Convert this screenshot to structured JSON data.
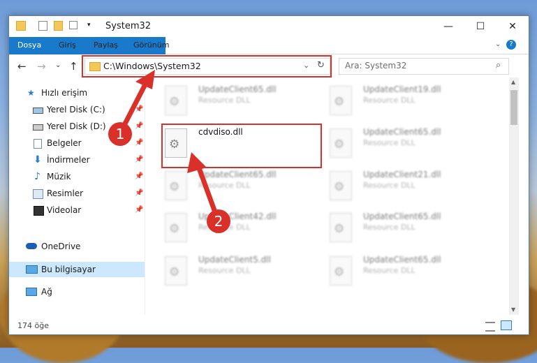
{
  "window": {
    "title": "System32",
    "controls": {
      "minimize": "—",
      "maximize": "☐",
      "close": "✕"
    }
  },
  "ribbon": {
    "tabs": [
      "Dosya",
      "Giriş",
      "Paylaş",
      "Görünüm"
    ],
    "help_icon": "?"
  },
  "navigation": {
    "back_icon": "←",
    "forward_icon": "→",
    "recent_icon": "⌄",
    "up_icon": "↑",
    "address": "C:\\Windows\\System32",
    "search_placeholder": "Ara: System32"
  },
  "sidebar": {
    "items": [
      {
        "label": "Hızlı erişim",
        "icon": "star-icon"
      },
      {
        "label": "Yerel Disk (C:)",
        "icon": "drive-icon",
        "pinned": true
      },
      {
        "label": "Yerel Disk (D:)",
        "icon": "drive-icon",
        "pinned": true
      },
      {
        "label": "Belgeler",
        "icon": "document-icon",
        "pinned": true
      },
      {
        "label": "İndirmeler",
        "icon": "download-icon",
        "pinned": true
      },
      {
        "label": "Müzik",
        "icon": "music-icon",
        "pinned": true
      },
      {
        "label": "Resimler",
        "icon": "picture-icon",
        "pinned": true
      },
      {
        "label": "Videolar",
        "icon": "video-icon",
        "pinned": true
      },
      {
        "label": "OneDrive",
        "icon": "cloud-icon"
      },
      {
        "label": "Bu bilgisayar",
        "icon": "computer-icon",
        "selected": true
      },
      {
        "label": "Ağ",
        "icon": "network-icon"
      }
    ]
  },
  "files": [
    {
      "name": "UpdateClient65.dll",
      "type": "Resource DLL",
      "blurred": true
    },
    {
      "name": "UpdateClient19.dll",
      "type": "Resource DLL",
      "blurred": true
    },
    {
      "name": "cdvdiso.dll",
      "type": "",
      "blurred": false
    },
    {
      "name": "UpdateClient65.dll",
      "type": "Resource DLL",
      "blurred": true
    },
    {
      "name": "UpdateClient65.dll",
      "type": "Resource DLL",
      "blurred": true
    },
    {
      "name": "UpdateClient21.dll",
      "type": "Resource DLL",
      "blurred": true
    },
    {
      "name": "UpdateClient42.dll",
      "type": "Resource DLL",
      "blurred": true
    },
    {
      "name": "UpdateClient65.dll",
      "type": "Resource DLL",
      "blurred": true
    },
    {
      "name": "UpdateClient5.dll",
      "type": "Resource DLL",
      "blurred": true
    },
    {
      "name": "UpdateClient65.dll",
      "type": "Resource DLL",
      "blurred": true
    }
  ],
  "status": {
    "count": "174 öğe"
  },
  "annotations": {
    "step1": "1",
    "step2": "2",
    "color": "#d9302a"
  }
}
